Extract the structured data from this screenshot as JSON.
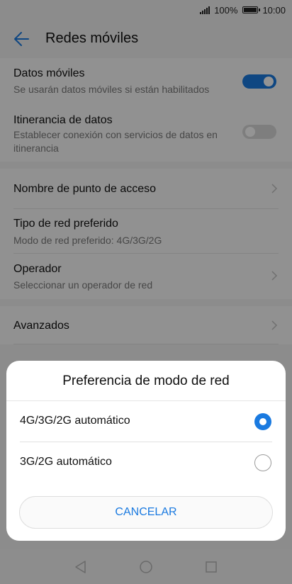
{
  "status_bar": {
    "battery": "100%",
    "time": "10:00",
    "icons": [
      "signal-icon",
      "battery-icon"
    ]
  },
  "header": {
    "title": "Redes móviles",
    "back_icon": "arrow-left-icon"
  },
  "settings": {
    "mobile_data": {
      "title": "Datos móviles",
      "subtitle": "Se usarán datos móviles si están habilitados",
      "enabled": true
    },
    "roaming": {
      "title": "Itinerancia de datos",
      "subtitle": "Establecer conexión con servicios de datos en itinerancia",
      "enabled": false
    },
    "apn": {
      "title": "Nombre de punto de acceso"
    },
    "network_type": {
      "title": "Tipo de red preferido",
      "subtitle": "Modo de red preferido: 4G/3G/2G"
    },
    "operator": {
      "title": "Operador",
      "subtitle": "Seleccionar un operador de red"
    },
    "advanced": {
      "title": "Avanzados"
    }
  },
  "dialog": {
    "title": "Preferencia de modo de red",
    "options": [
      {
        "label": "4G/3G/2G automático",
        "selected": true
      },
      {
        "label": "3G/2G automático",
        "selected": false
      }
    ],
    "cancel_label": "CANCELAR"
  },
  "colors": {
    "accent": "#1a7ae0",
    "toggle_off": "#d9d9d9"
  },
  "nav_bar": {
    "icons": [
      "back-triangle-icon",
      "home-circle-icon",
      "recents-square-icon"
    ]
  }
}
